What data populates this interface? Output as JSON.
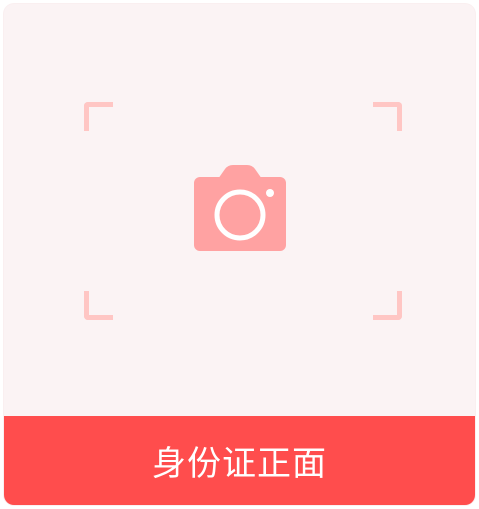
{
  "card": {
    "label": "身份证正面"
  },
  "icons": {
    "camera": "camera-icon",
    "frame": "scan-frame-corners"
  },
  "colors": {
    "card_background": "#fbf3f4",
    "accent": "#ff4d4d",
    "frame_corners": "#ffc6c4",
    "camera_icon": "#ffa2a2"
  }
}
